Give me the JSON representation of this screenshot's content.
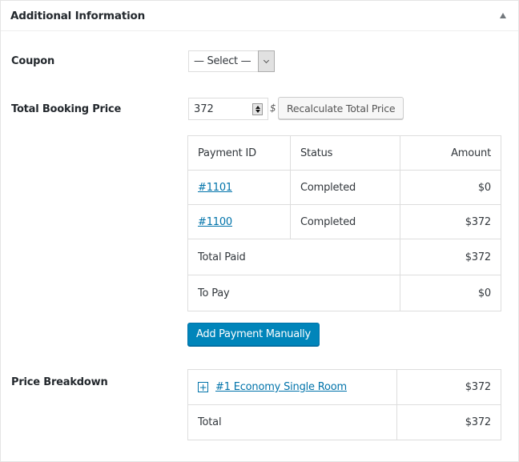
{
  "panel": {
    "title": "Additional Information",
    "toggle_icon": "triangle-up-icon"
  },
  "coupon": {
    "label": "Coupon",
    "selected": "— Select —"
  },
  "total_price": {
    "label": "Total Booking Price",
    "value": "372",
    "currency_symbol": "$",
    "recalculate_label": "Recalculate Total Price"
  },
  "payments": {
    "headers": [
      "Payment ID",
      "Status",
      "Amount"
    ],
    "rows": [
      {
        "id": "#1101",
        "status": "Completed",
        "amount": "$0"
      },
      {
        "id": "#1100",
        "status": "Completed",
        "amount": "$372"
      }
    ],
    "total_paid_label": "Total Paid",
    "total_paid": "$372",
    "to_pay_label": "To Pay",
    "to_pay": "$0",
    "add_button_label": "Add Payment Manually"
  },
  "breakdown": {
    "label": "Price Breakdown",
    "items": [
      {
        "name": "#1 Economy Single Room",
        "amount": "$372",
        "expand_icon": "+"
      }
    ],
    "total_label": "Total",
    "total": "$372"
  },
  "colors": {
    "link": "#0073aa",
    "primary_button": "#0085ba"
  }
}
